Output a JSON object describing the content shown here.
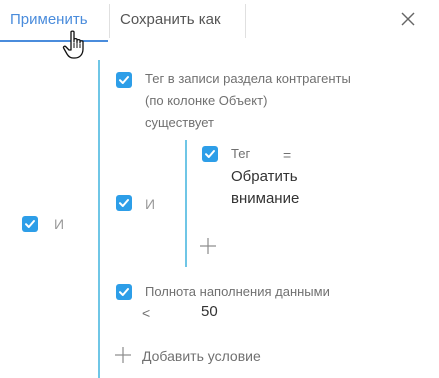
{
  "toolbar": {
    "apply_label": "Применить",
    "save_as_label": "Сохранить как",
    "close_icon": "close-icon",
    "accent_color": "#4a8cdc"
  },
  "filter": {
    "root_operator": "И",
    "conditions": [
      {
        "line1": "Тег в записи раздела контрагенты",
        "line2": "(по колонке Объект)",
        "line3": "существует",
        "checked": true
      }
    ],
    "subgroup": {
      "operator": "И",
      "condition": {
        "column": "Тег",
        "comparison": "=",
        "value_line1": "Обратить",
        "value_line2": "внимание",
        "checked": true
      },
      "add_icon": "plus-icon"
    },
    "condition_fullness": {
      "column": "Полнота наполнения данными",
      "comparison": "<",
      "value": "50",
      "checked": true
    },
    "add_condition_label": "Добавить условие",
    "line_color": "#6fc6e6",
    "checkbox_color": "#2d9ee8"
  }
}
